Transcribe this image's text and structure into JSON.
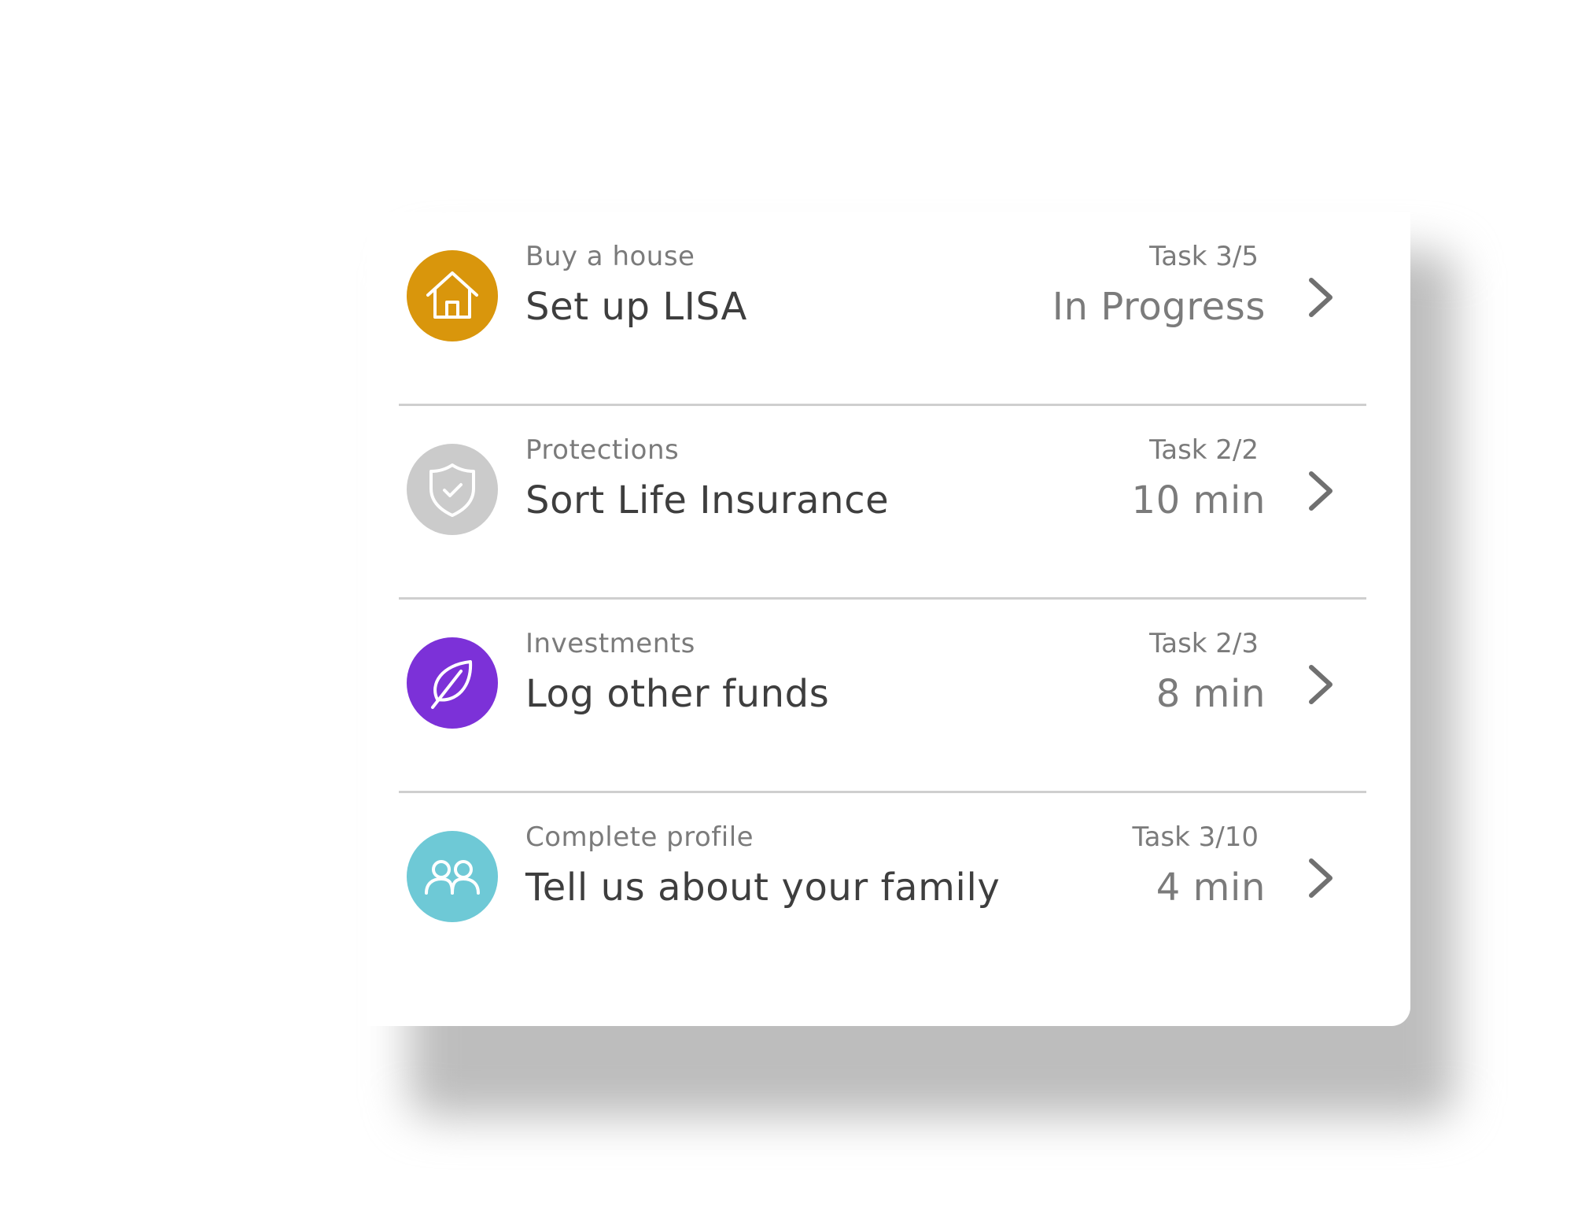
{
  "colors": {
    "house": "#d9960c",
    "protections": "#cbcbcb",
    "investments": "#7c31d8",
    "profile": "#6ec9d6"
  },
  "tasks": [
    {
      "icon": "house-icon",
      "category": "Buy a house",
      "title": "Set up LISA",
      "step": "Task 3/5",
      "status": "In Progress"
    },
    {
      "icon": "shield-check-icon",
      "category": "Protections",
      "title": "Sort Life Insurance",
      "step": "Task 2/2",
      "status": "10 min"
    },
    {
      "icon": "leaf-icon",
      "category": "Investments",
      "title": "Log other funds",
      "step": "Task 2/3",
      "status": "8 min"
    },
    {
      "icon": "people-icon",
      "category": "Complete profile",
      "title": "Tell us about your family",
      "step": "Task 3/10",
      "status": "4 min"
    }
  ]
}
